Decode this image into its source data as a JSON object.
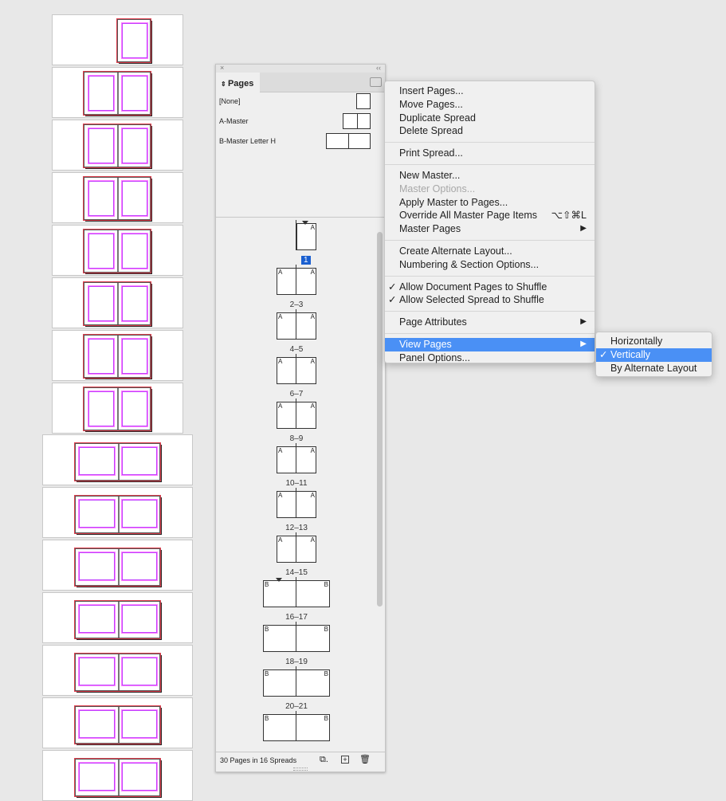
{
  "document_thumbnails": {
    "portrait_count": 8,
    "landscape_count": 7,
    "first_is_single_page": true
  },
  "panel": {
    "close_icon": "close-icon",
    "collapse_icon": "double-chevron-icon",
    "tab_label": "Pages",
    "masters": [
      {
        "name": "[None]",
        "pages": 1
      },
      {
        "name": "A-Master",
        "pages": 2
      },
      {
        "name": "B-Master Letter H",
        "pages": 2
      }
    ],
    "pages": [
      {
        "label": "1",
        "master": "A",
        "single": true,
        "selected": true
      },
      {
        "label": "2–3",
        "master": "A"
      },
      {
        "label": "4–5",
        "master": "A"
      },
      {
        "label": "6–7",
        "master": "A"
      },
      {
        "label": "8–9",
        "master": "A"
      },
      {
        "label": "10–11",
        "master": "A"
      },
      {
        "label": "12–13",
        "master": "A"
      },
      {
        "label": "14–15",
        "master": "A"
      },
      {
        "label": "16–17",
        "master": "B",
        "section_start": true
      },
      {
        "label": "18–19",
        "master": "B"
      },
      {
        "label": "20–21",
        "master": "B"
      },
      {
        "label": "",
        "master": "B"
      }
    ],
    "footer_status": "30 Pages in 16 Spreads"
  },
  "menu": {
    "groups": [
      [
        {
          "label": "Insert Pages..."
        },
        {
          "label": "Move Pages..."
        },
        {
          "label": "Duplicate Spread"
        },
        {
          "label": "Delete Spread"
        }
      ],
      [
        {
          "label": "Print Spread..."
        }
      ],
      [
        {
          "label": "New Master..."
        },
        {
          "label": "Master Options...",
          "disabled": true
        },
        {
          "label": "Apply Master to Pages..."
        },
        {
          "label": "Override All Master Page Items",
          "shortcut": "⌥⇧⌘L"
        },
        {
          "label": "Master Pages",
          "submenu": true
        }
      ],
      [
        {
          "label": "Create Alternate Layout..."
        },
        {
          "label": "Numbering & Section Options..."
        }
      ],
      [
        {
          "label": "Allow Document Pages to Shuffle",
          "checked": true
        },
        {
          "label": "Allow Selected Spread to Shuffle",
          "checked": true
        }
      ],
      [
        {
          "label": "Page Attributes",
          "submenu": true
        }
      ],
      [
        {
          "label": "View Pages",
          "submenu": true,
          "highlighted": true
        },
        {
          "label": "Panel Options..."
        }
      ]
    ]
  },
  "submenu": {
    "items": [
      {
        "label": "Horizontally"
      },
      {
        "label": "Vertically",
        "checked": true,
        "highlighted": true
      },
      {
        "label": "By Alternate Layout"
      }
    ]
  },
  "colors": {
    "highlight": "#4a90f5",
    "margin": "#c040ff",
    "bleed": "#e0404f"
  }
}
